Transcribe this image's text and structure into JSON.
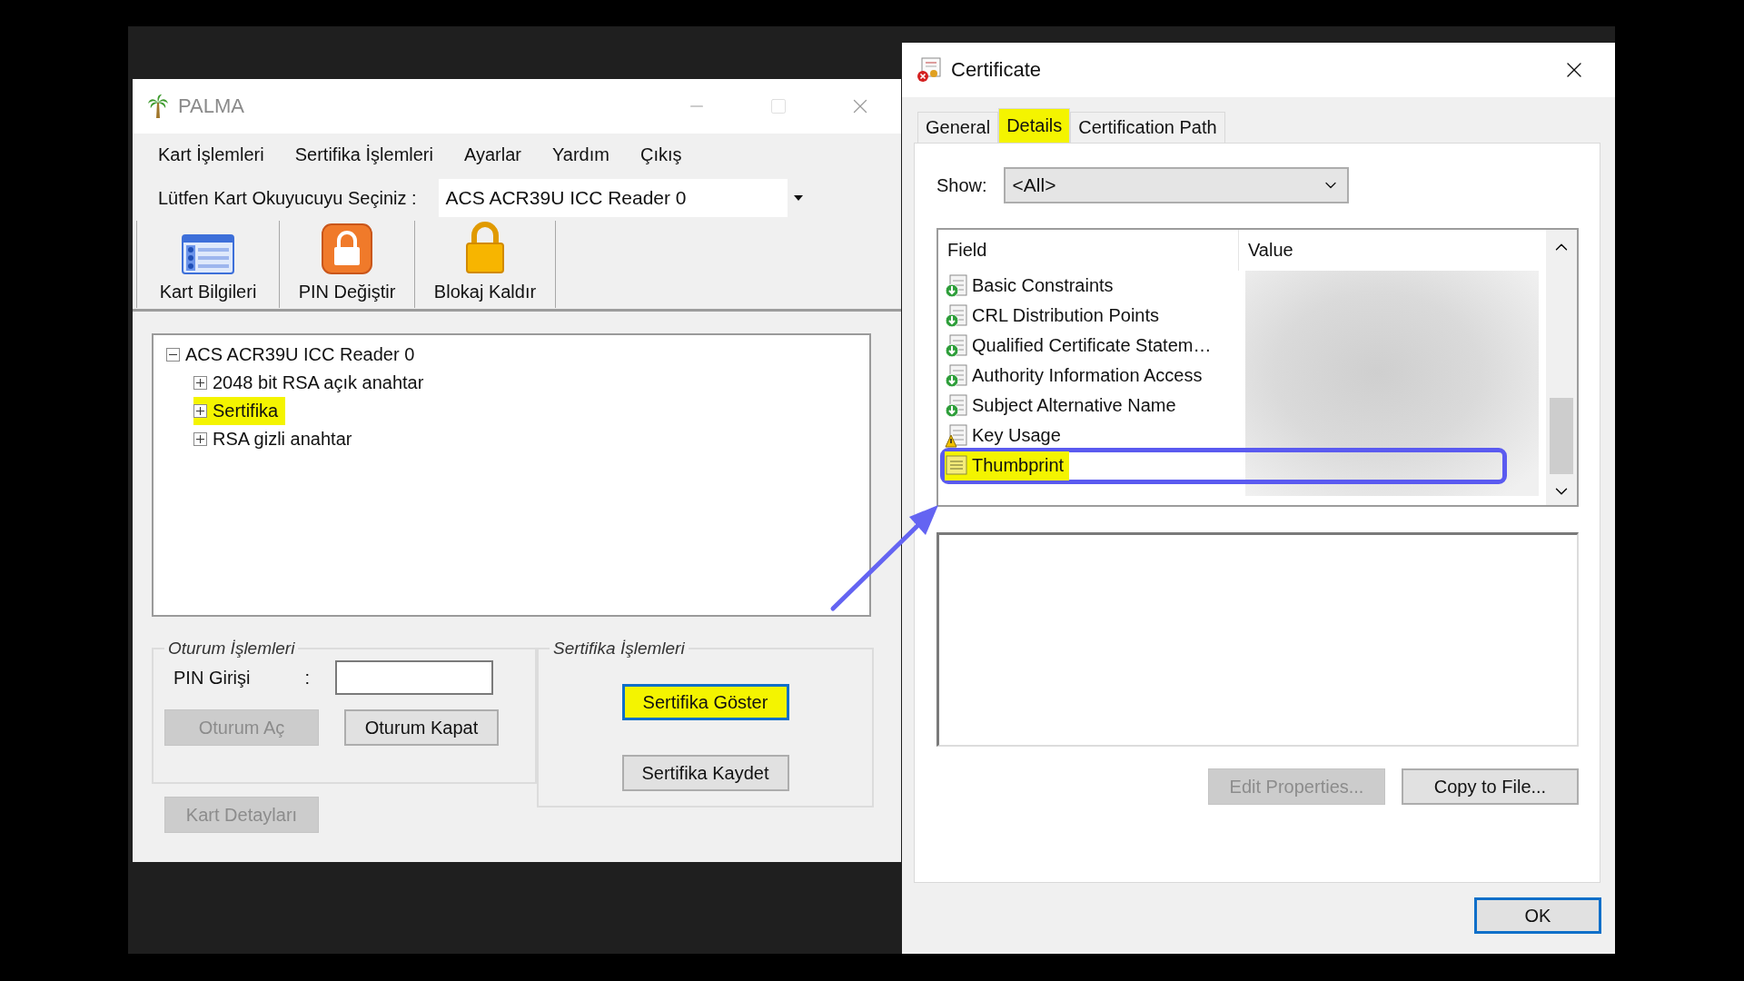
{
  "palma_window": {
    "title": "PALMA",
    "menu": [
      "Kart İşlemleri",
      "Sertifika İşlemleri",
      "Ayarlar",
      "Yardım",
      "Çıkış"
    ],
    "reader_label": "Lütfen Kart Okuyucuyu Seçiniz :",
    "reader_value": "ACS ACR39U ICC Reader 0",
    "toolbar": [
      {
        "label": "Kart Bilgileri",
        "kind": "card"
      },
      {
        "label": "PIN Değiştir",
        "kind": "pin"
      },
      {
        "label": "Blokaj Kaldır",
        "kind": "unlock"
      }
    ],
    "tree": {
      "label": "ACS ACR39U ICC Reader 0",
      "expanded": true,
      "highlighted": false,
      "children": [
        {
          "label": "2048 bit RSA açık anahtar",
          "expanded": false,
          "highlighted": false
        },
        {
          "label": "Sertifika",
          "expanded": false,
          "highlighted": true
        },
        {
          "label": "RSA gizli anahtar",
          "expanded": false,
          "highlighted": false
        }
      ]
    },
    "session_group": {
      "title": "Oturum İşlemleri",
      "pin_label": "PIN Girişi",
      "pin_colon": ":",
      "buttons": [
        {
          "label": "Oturum Aç",
          "disabled": true
        },
        {
          "label": "Oturum Kapat",
          "disabled": false
        }
      ]
    },
    "details_button": {
      "label": "Kart Detayları",
      "disabled": true
    },
    "certificate_group": {
      "title": "Sertifika İşlemleri",
      "buttons": [
        {
          "label": "Sertifika Göster",
          "highlighted": true,
          "focused": true
        },
        {
          "label": "Sertifika Kaydet",
          "highlighted": false,
          "focused": false
        }
      ]
    }
  },
  "certificate_window": {
    "title": "Certificate",
    "tabs": [
      {
        "label": "General",
        "selected": false,
        "highlighted": false
      },
      {
        "label": "Details",
        "selected": true,
        "highlighted": true
      },
      {
        "label": "Certification Path",
        "selected": false,
        "highlighted": false
      }
    ],
    "show_label": "Show:",
    "show_value": "<All>",
    "columns": [
      "Field",
      "Value"
    ],
    "fields": [
      {
        "name": "Basic Constraints",
        "kind": "extension",
        "highlighted": false,
        "outlined": false
      },
      {
        "name": "CRL Distribution Points",
        "kind": "extension",
        "highlighted": false,
        "outlined": false
      },
      {
        "name": "Qualified Certificate Statem…",
        "kind": "extension",
        "highlighted": false,
        "outlined": false
      },
      {
        "name": "Authority Information Access",
        "kind": "extension",
        "highlighted": false,
        "outlined": false
      },
      {
        "name": "Subject Alternative Name",
        "kind": "extension",
        "highlighted": false,
        "outlined": false
      },
      {
        "name": "Key Usage",
        "kind": "critical",
        "highlighted": false,
        "outlined": false
      },
      {
        "name": "Thumbprint",
        "kind": "property",
        "highlighted": true,
        "outlined": true
      }
    ],
    "buttons": [
      {
        "label": "Edit Properties...",
        "disabled": true
      },
      {
        "label": "Copy to File...",
        "disabled": false
      }
    ],
    "ok_button": {
      "label": "OK",
      "focused": true
    }
  }
}
